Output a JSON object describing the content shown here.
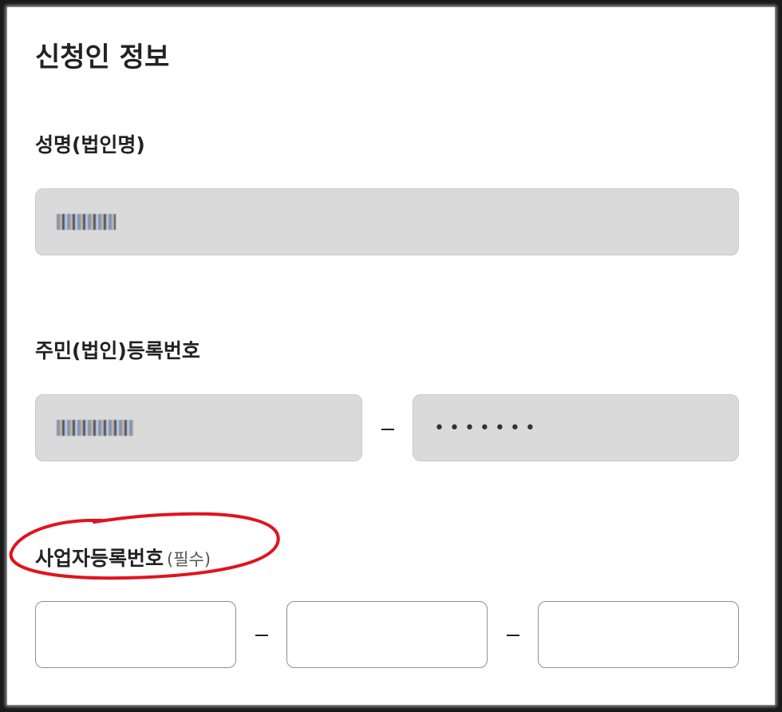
{
  "page": {
    "title": "신청인 정보"
  },
  "name_section": {
    "label": "성명(법인명)",
    "value": "김바다"
  },
  "resident_section": {
    "label": "주민(법인)등록번호",
    "front_value": "880101",
    "back_value": "•••••••"
  },
  "business_section": {
    "label": "사업자등록번호",
    "required_note": "(필수)",
    "part1": "",
    "part2": "",
    "part3": ""
  },
  "colors": {
    "annotation": "#e0141e",
    "readonly_field_bg": "#dadada"
  }
}
